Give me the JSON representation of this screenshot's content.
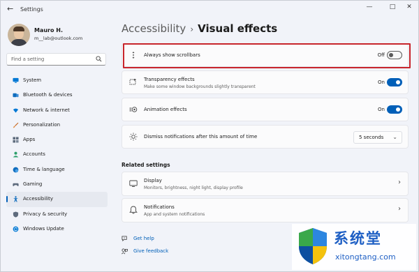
{
  "window": {
    "title": "Settings",
    "back_glyph": "←",
    "min_glyph": "—",
    "max_glyph": "□",
    "close_glyph": "✕"
  },
  "profile": {
    "name": "Mauro H.",
    "email": "m__lab@outlook.com"
  },
  "search": {
    "placeholder": "Find a setting"
  },
  "sidebar": {
    "items": [
      {
        "label": "System",
        "icon": "monitor-icon",
        "color": "#0078d4"
      },
      {
        "label": "Bluetooth & devices",
        "icon": "bluetooth-devices-icon",
        "color": "#0f6cbd"
      },
      {
        "label": "Network & internet",
        "icon": "wifi-icon",
        "color": "#0078d4"
      },
      {
        "label": "Personalization",
        "icon": "brush-icon",
        "color": "#c4621b"
      },
      {
        "label": "Apps",
        "icon": "apps-grid-icon",
        "color": "#5e6b7d"
      },
      {
        "label": "Accounts",
        "icon": "person-icon",
        "color": "#2c9f6b"
      },
      {
        "label": "Time & language",
        "icon": "globe-clock-icon",
        "color": "#0f6cbd"
      },
      {
        "label": "Gaming",
        "icon": "gamepad-icon",
        "color": "#5e6b7d"
      },
      {
        "label": "Accessibility",
        "icon": "accessibility-icon",
        "color": "#0f6cbd"
      },
      {
        "label": "Privacy & security",
        "icon": "shield-icon",
        "color": "#5e6b7d"
      },
      {
        "label": "Windows Update",
        "icon": "sync-icon",
        "color": "#0078d4"
      }
    ],
    "active_index": 8
  },
  "breadcrumb": {
    "parent": "Accessibility",
    "separator": "›",
    "current": "Visual effects"
  },
  "settings": [
    {
      "title": "Always show scrollbars",
      "subtitle": "",
      "state": "Off",
      "on": false,
      "icon": "scrollbar-icon"
    },
    {
      "title": "Transparency effects",
      "subtitle": "Make some window backgrounds slightly transparent",
      "state": "On",
      "on": true,
      "icon": "transparency-icon"
    },
    {
      "title": "Animation effects",
      "subtitle": "",
      "state": "On",
      "on": true,
      "icon": "animation-icon"
    },
    {
      "title": "Dismiss notifications after this amount of time",
      "subtitle": "",
      "dropdown_value": "5 seconds",
      "icon": "brightness-icon"
    }
  ],
  "related": {
    "title": "Related settings",
    "items": [
      {
        "title": "Display",
        "subtitle": "Monitors, brightness, night light, display profile",
        "icon": "display-icon"
      },
      {
        "title": "Notifications",
        "subtitle": "App and system notifications",
        "icon": "bell-icon"
      }
    ],
    "chevron": "›"
  },
  "help": {
    "get_help": "Get help",
    "give_feedback": "Give feedback"
  },
  "watermark": {
    "chinese": "系统堂",
    "site": "xitongtang.com"
  },
  "colors": {
    "accent": "#005fb8",
    "highlight_border": "#c8252c",
    "watermark_blue": "#1e5fc4"
  }
}
